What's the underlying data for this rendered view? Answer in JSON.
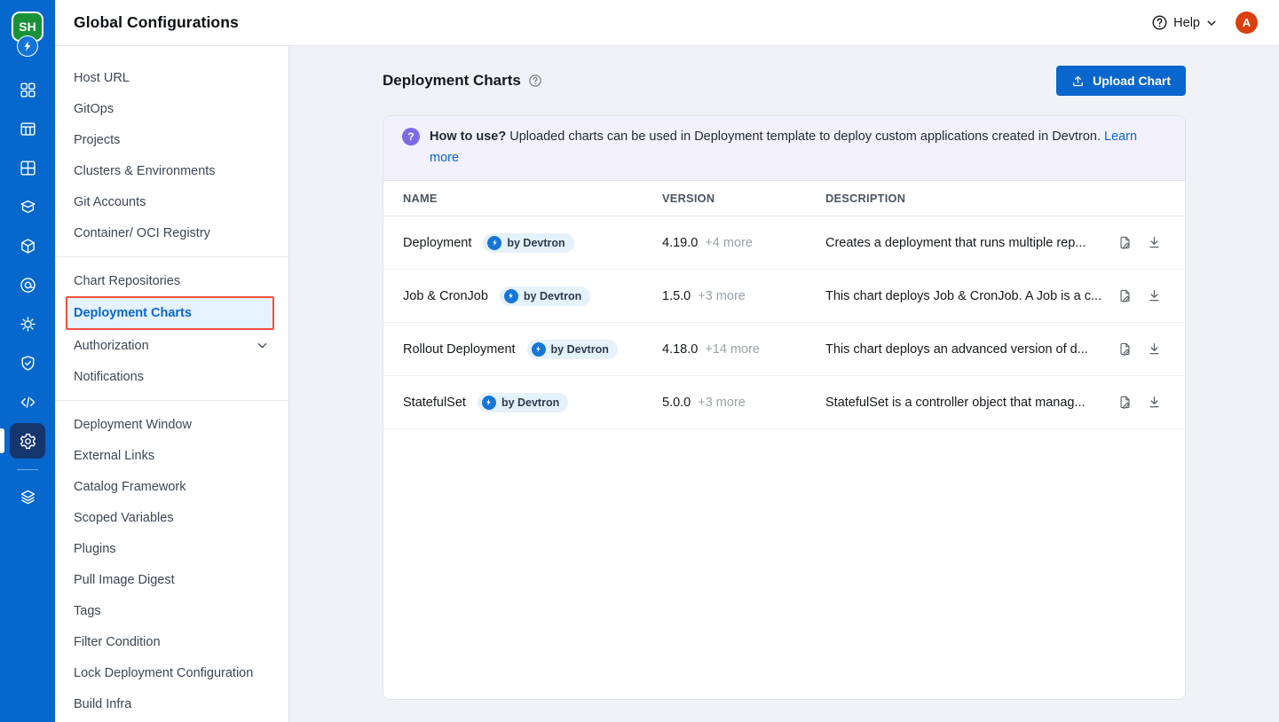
{
  "brand": {
    "logo_text": "SH"
  },
  "rail": {
    "items": [
      {
        "icon": "apps-grid-icon"
      },
      {
        "icon": "jobs-table-icon"
      },
      {
        "icon": "app-group-icon"
      },
      {
        "icon": "chart-store-icon"
      },
      {
        "icon": "resource-cube-icon"
      },
      {
        "icon": "target-icon"
      },
      {
        "icon": "cog-flower-icon"
      },
      {
        "icon": "shield-check-icon"
      },
      {
        "icon": "code-icon"
      },
      {
        "icon": "gear-icon",
        "selected": true
      },
      {
        "divider": true
      },
      {
        "icon": "stack-icon"
      }
    ]
  },
  "header": {
    "title": "Global Configurations",
    "help_label": "Help",
    "avatar_initial": "A"
  },
  "sidebar": {
    "groups": [
      {
        "items": [
          {
            "label": "Host URL"
          },
          {
            "label": "GitOps"
          },
          {
            "label": "Projects"
          },
          {
            "label": "Clusters & Environments"
          },
          {
            "label": "Git Accounts"
          },
          {
            "label": "Container/ OCI Registry"
          }
        ]
      },
      {
        "items": [
          {
            "label": "Chart Repositories"
          },
          {
            "label": "Deployment Charts",
            "selected": true
          },
          {
            "label": "Authorization",
            "chevron": true
          },
          {
            "label": "Notifications"
          }
        ]
      },
      {
        "items": [
          {
            "label": "Deployment Window"
          },
          {
            "label": "External Links"
          },
          {
            "label": "Catalog Framework"
          },
          {
            "label": "Scoped Variables"
          },
          {
            "label": "Plugins"
          },
          {
            "label": "Pull Image Digest"
          },
          {
            "label": "Tags"
          },
          {
            "label": "Filter Condition"
          },
          {
            "label": "Lock Deployment Configuration"
          },
          {
            "label": "Build Infra"
          }
        ]
      }
    ]
  },
  "main": {
    "title": "Deployment Charts",
    "upload_button": "Upload Chart",
    "banner": {
      "badge": "?",
      "bold": "How to use?",
      "text": " Uploaded charts can be used in Deployment template to deploy custom applications created in Devtron. ",
      "link": "Learn more"
    },
    "table": {
      "columns": [
        "NAME",
        "VERSION",
        "DESCRIPTION"
      ],
      "rows": [
        {
          "name": "Deployment",
          "badge": "by Devtron",
          "version": "4.19.0",
          "more": "+4 more",
          "description": "Creates a deployment that runs multiple rep..."
        },
        {
          "name": "Job & CronJob",
          "badge": "by Devtron",
          "version": "1.5.0",
          "more": "+3 more",
          "description": "This chart deploys Job & CronJob. A Job is a c..."
        },
        {
          "name": "Rollout Deployment",
          "badge": "by Devtron",
          "version": "4.18.0",
          "more": "+14 more",
          "description": "This chart deploys an advanced version of d..."
        },
        {
          "name": "StatefulSet",
          "badge": "by Devtron",
          "version": "5.0.0",
          "more": "+3 more",
          "description": "StatefulSet is a controller object that manag..."
        }
      ]
    }
  }
}
